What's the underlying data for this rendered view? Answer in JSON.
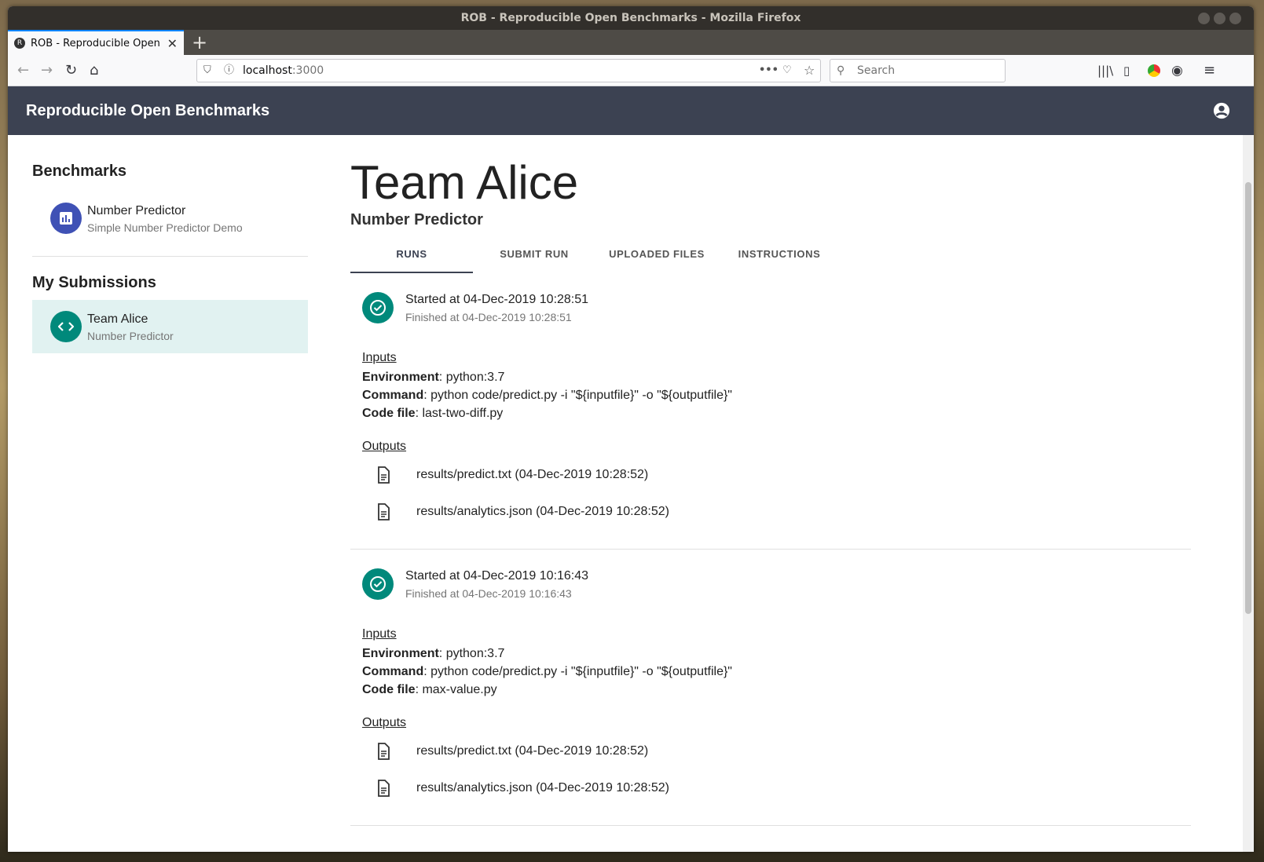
{
  "window": {
    "title": "ROB - Reproducible Open Benchmarks - Mozilla Firefox"
  },
  "browser": {
    "tab_title": "ROB - Reproducible Open Benchmarks",
    "tab_favicon": "R",
    "url_host": "localhost",
    "url_port": ":3000",
    "search_placeholder": "Search"
  },
  "app": {
    "brand": "Reproducible Open Benchmarks",
    "accent": "#3c4252",
    "success": "#00897b"
  },
  "sidebar": {
    "benchmarks_heading": "Benchmarks",
    "benchmarks": [
      {
        "title": "Number Predictor",
        "subtitle": "Simple Number Predictor Demo",
        "icon": "bar-chart-icon"
      }
    ],
    "submissions_heading": "My Submissions",
    "submissions": [
      {
        "title": "Team Alice",
        "subtitle": "Number Predictor",
        "icon": "code-icon"
      }
    ]
  },
  "page": {
    "title": "Team Alice",
    "subtitle": "Number Predictor",
    "tabs": [
      {
        "label": "RUNS",
        "active": true
      },
      {
        "label": "SUBMIT RUN",
        "active": false
      },
      {
        "label": "UPLOADED FILES",
        "active": false
      },
      {
        "label": "INSTRUCTIONS",
        "active": false
      }
    ]
  },
  "labels": {
    "inputs": "Inputs",
    "outputs": "Outputs",
    "environment": "Environment",
    "command": "Command",
    "code_file": "Code file"
  },
  "runs": [
    {
      "started": "Started at 04-Dec-2019 10:28:51",
      "finished": "Finished at 04-Dec-2019 10:28:51",
      "environment": ": python:3.7",
      "command": ": python code/predict.py -i \"${inputfile}\" -o \"${outputfile}\"",
      "code_file": ": last-two-diff.py",
      "outputs": [
        "results/predict.txt (04-Dec-2019 10:28:52)",
        "results/analytics.json (04-Dec-2019 10:28:52)"
      ]
    },
    {
      "started": "Started at 04-Dec-2019 10:16:43",
      "finished": "Finished at 04-Dec-2019 10:16:43",
      "environment": ": python:3.7",
      "command": ": python code/predict.py -i \"${inputfile}\" -o \"${outputfile}\"",
      "code_file": ": max-value.py",
      "outputs": [
        "results/predict.txt (04-Dec-2019 10:28:52)",
        "results/analytics.json (04-Dec-2019 10:28:52)"
      ]
    }
  ]
}
